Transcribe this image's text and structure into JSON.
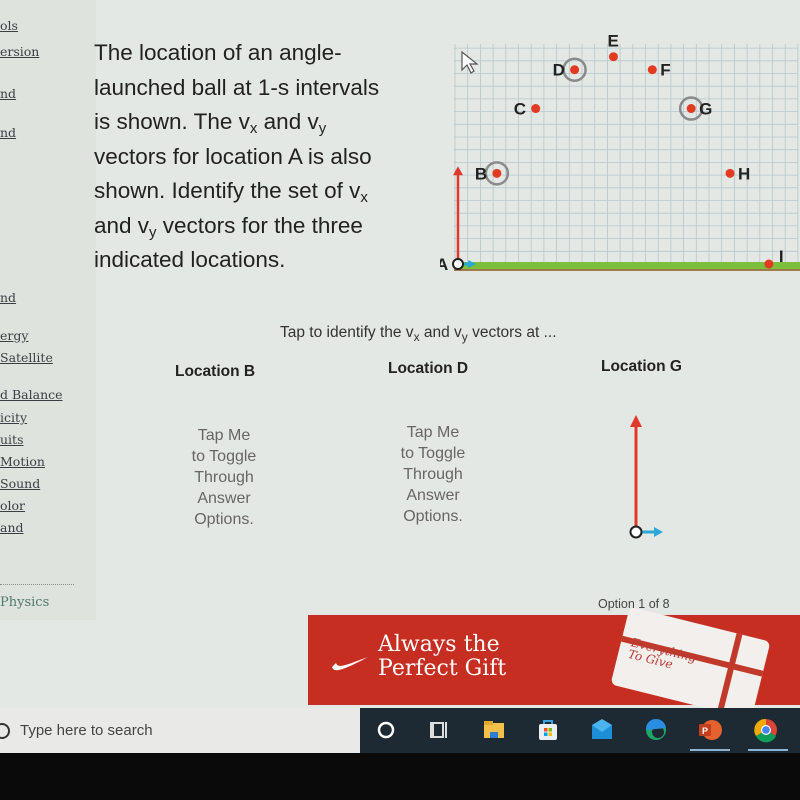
{
  "sidebar": {
    "items": [
      {
        "label": "ols"
      },
      {
        "label": "ersion"
      },
      {
        "label": "nd"
      },
      {
        "label": "nd"
      },
      {
        "label": "nd"
      },
      {
        "label": "ergy"
      },
      {
        "label": " Satellite"
      },
      {
        "label": "d Balance"
      },
      {
        "label": "icity"
      },
      {
        "label": "uits"
      },
      {
        "label": " Motion"
      },
      {
        "label": " Sound"
      },
      {
        "label": "olor"
      },
      {
        "label": "and"
      }
    ],
    "footer": "Physics"
  },
  "question": {
    "line1": "The location of an angle-",
    "line2": "launched ball at 1-s intervals",
    "line3a": "is shown. The v",
    "sub_x": "x",
    "line3b": " and v",
    "sub_y": "y",
    "line4": "vectors for location A is also",
    "line5a": "shown. Identify the set of v",
    "line6a": "and v",
    "line6b": " vectors for the three",
    "line7": "indicated locations."
  },
  "figure": {
    "points": [
      {
        "label": "A",
        "gx": 0,
        "gy": 0,
        "circled": false,
        "start": true
      },
      {
        "label": "B",
        "gx": 3,
        "gy": 7,
        "circled": true
      },
      {
        "label": "C",
        "gx": 6,
        "gy": 12,
        "circled": false
      },
      {
        "label": "D",
        "gx": 9,
        "gy": 15,
        "circled": true
      },
      {
        "label": "E",
        "gx": 12,
        "gy": 16,
        "circled": false
      },
      {
        "label": "F",
        "gx": 15,
        "gy": 15,
        "circled": false
      },
      {
        "label": "G",
        "gx": 18,
        "gy": 12,
        "circled": true
      },
      {
        "label": "H",
        "gx": 21,
        "gy": 7,
        "circled": false
      },
      {
        "label": "I",
        "gx": 24,
        "gy": 0,
        "circled": false
      }
    ],
    "vector_a": {
      "vx": 1,
      "vy": 7
    },
    "colors": {
      "point": "#e23b22",
      "vy_arrow": "#e0382b",
      "vx_arrow": "#2aa8d8",
      "grass": "#7cbf3a",
      "grid": "#b8c6cc"
    }
  },
  "prompt": {
    "text_a": "Tap to identify the v",
    "sub_x": "x",
    "text_b": " and v",
    "sub_y": "y",
    "text_c": " vectors at ..."
  },
  "locations": [
    {
      "heading": "Location B",
      "answer": [
        "Tap Me",
        "to Toggle",
        "Through",
        "Answer",
        "Options."
      ]
    },
    {
      "heading": "Location D",
      "answer": [
        "Tap Me",
        "to Toggle",
        "Through",
        "Answer",
        "Options."
      ]
    },
    {
      "heading": "Location G",
      "answer_vector": {
        "vx": 1,
        "vy": 7
      }
    }
  ],
  "option_counter": "Option 1 of 8",
  "ad": {
    "line1": "Always the",
    "line2": "Perfect Gift",
    "card_line1": "Everything",
    "card_line2": "To Give",
    "color": "#c72e22"
  },
  "taskbar": {
    "search_placeholder": "Type here to search",
    "icons": [
      "cortana-icon",
      "task-view-icon",
      "file-explorer-icon",
      "store-icon",
      "mail-icon",
      "edge-icon",
      "powerpoint-icon",
      "chrome-icon"
    ]
  }
}
